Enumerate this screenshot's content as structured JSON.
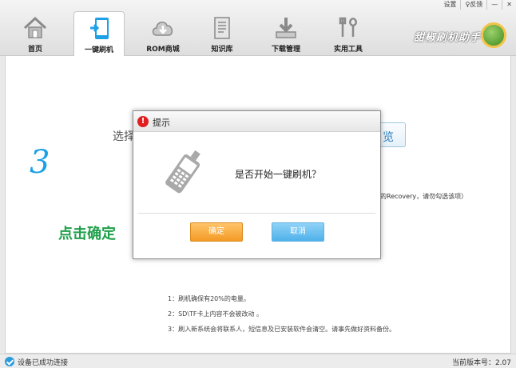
{
  "window_controls": {
    "settings": "设置",
    "feedback": "♀反馈"
  },
  "nav": {
    "tabs": [
      {
        "label": "首页",
        "icon": "home-icon"
      },
      {
        "label": "一键刷机",
        "icon": "flash-phone-icon",
        "active": true
      },
      {
        "label": "ROM商城",
        "icon": "cloud-download-icon"
      },
      {
        "label": "知识库",
        "icon": "document-icon"
      },
      {
        "label": "下载管理",
        "icon": "download-tray-icon"
      },
      {
        "label": "实用工具",
        "icon": "tools-icon"
      }
    ]
  },
  "brand": {
    "name": "甜椒刷机助手",
    "logo": "android-logo-icon"
  },
  "main": {
    "step_number": "3",
    "step_hint": "点击确定",
    "select_label": "选择",
    "browse_label": "览",
    "recovery_note": "用的Recovery，请勿勾选该项）",
    "notes": [
      "1：刷机确保有20%的电量。",
      "2：SD\\TF卡上内容不会被改动 。",
      "3：刷入新系统会将联系人，短信息及已安装软件会清空。请事先做好资料备份。"
    ]
  },
  "dialog": {
    "title": "提示",
    "warning_symbol": "!",
    "message": "是否开始一键刷机？",
    "ok_label": "确定",
    "cancel_label": "取消"
  },
  "status": {
    "text": "设备已成功连接",
    "version": "当前版本号：2.07"
  },
  "colors": {
    "accent": "#1ea0e6",
    "hint_green": "#20a04b",
    "ok_orange": "#f39a25",
    "cancel_blue": "#4fb1ea"
  }
}
